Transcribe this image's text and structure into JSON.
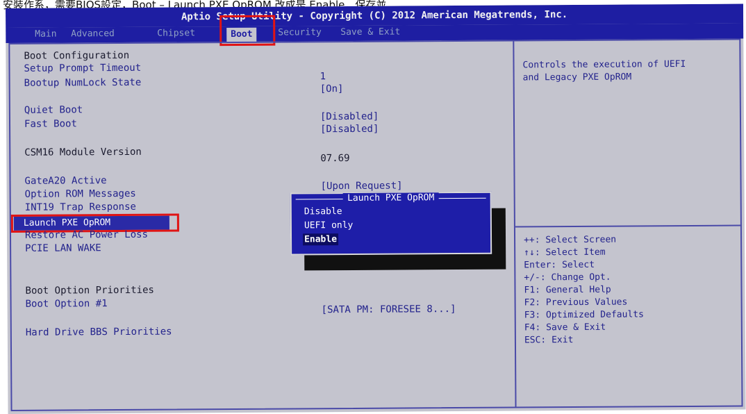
{
  "caption": "安裝作系，需要BIOS設定，Boot – Launch PXE OpROM 改成是 Enable，保存並",
  "bios": {
    "title": "Aptio Setup Utility - Copyright (C) 2012 American Megatrends, Inc.",
    "tabs": [
      "Main",
      "Advanced",
      "Chipset",
      "Boot",
      "Security",
      "Save & Exit"
    ],
    "active_tab": "Boot",
    "colors": {
      "header": "#1e1ea2",
      "panel": "#c4c4ce",
      "highlight": "#e01414"
    },
    "menu": {
      "boot_config_heading": "Boot Configuration",
      "setup_prompt_timeout": {
        "label": "Setup Prompt Timeout",
        "value": "1"
      },
      "bootup_numlock": {
        "label": "Bootup NumLock State",
        "value": "[On]"
      },
      "quiet_boot": {
        "label": "Quiet Boot",
        "value": "[Disabled]"
      },
      "fast_boot": {
        "label": "Fast Boot",
        "value": "[Disabled]"
      },
      "csm16": {
        "label": "CSM16 Module Version",
        "value": "07.69"
      },
      "gatea20": {
        "label": "GateA20 Active",
        "value": "[Upon Request]"
      },
      "option_rom_messages": {
        "label": "Option ROM Messages"
      },
      "int19": {
        "label": "INT19 Trap Response"
      },
      "launch_pxe": {
        "label": "Launch PXE OpROM"
      },
      "restore_ac": {
        "label": "Restore AC Power Loss"
      },
      "pcie_lan_wake": {
        "label": "PCIE LAN WAKE"
      },
      "boot_option_priorities": "Boot Option Priorities",
      "boot_option_1": {
        "label": "Boot Option #1",
        "value": "[SATA  PM: FORESEE 8...]"
      },
      "hdd_bbs": "Hard Drive BBS Priorities"
    },
    "popup": {
      "title": "Launch PXE OpROM",
      "options": [
        "Disable",
        "UEFI only",
        "Enable"
      ],
      "selected": "Enable"
    },
    "help": {
      "description_line1": "Controls the execution of UEFI",
      "description_line2": "and Legacy PXE OpROM",
      "keys": [
        "++: Select Screen",
        "↑↓: Select Item",
        "Enter: Select",
        "+/-: Change Opt.",
        "F1: General Help",
        "F2: Previous Values",
        "F3: Optimized Defaults",
        "F4: Save & Exit",
        "ESC: Exit"
      ]
    }
  }
}
